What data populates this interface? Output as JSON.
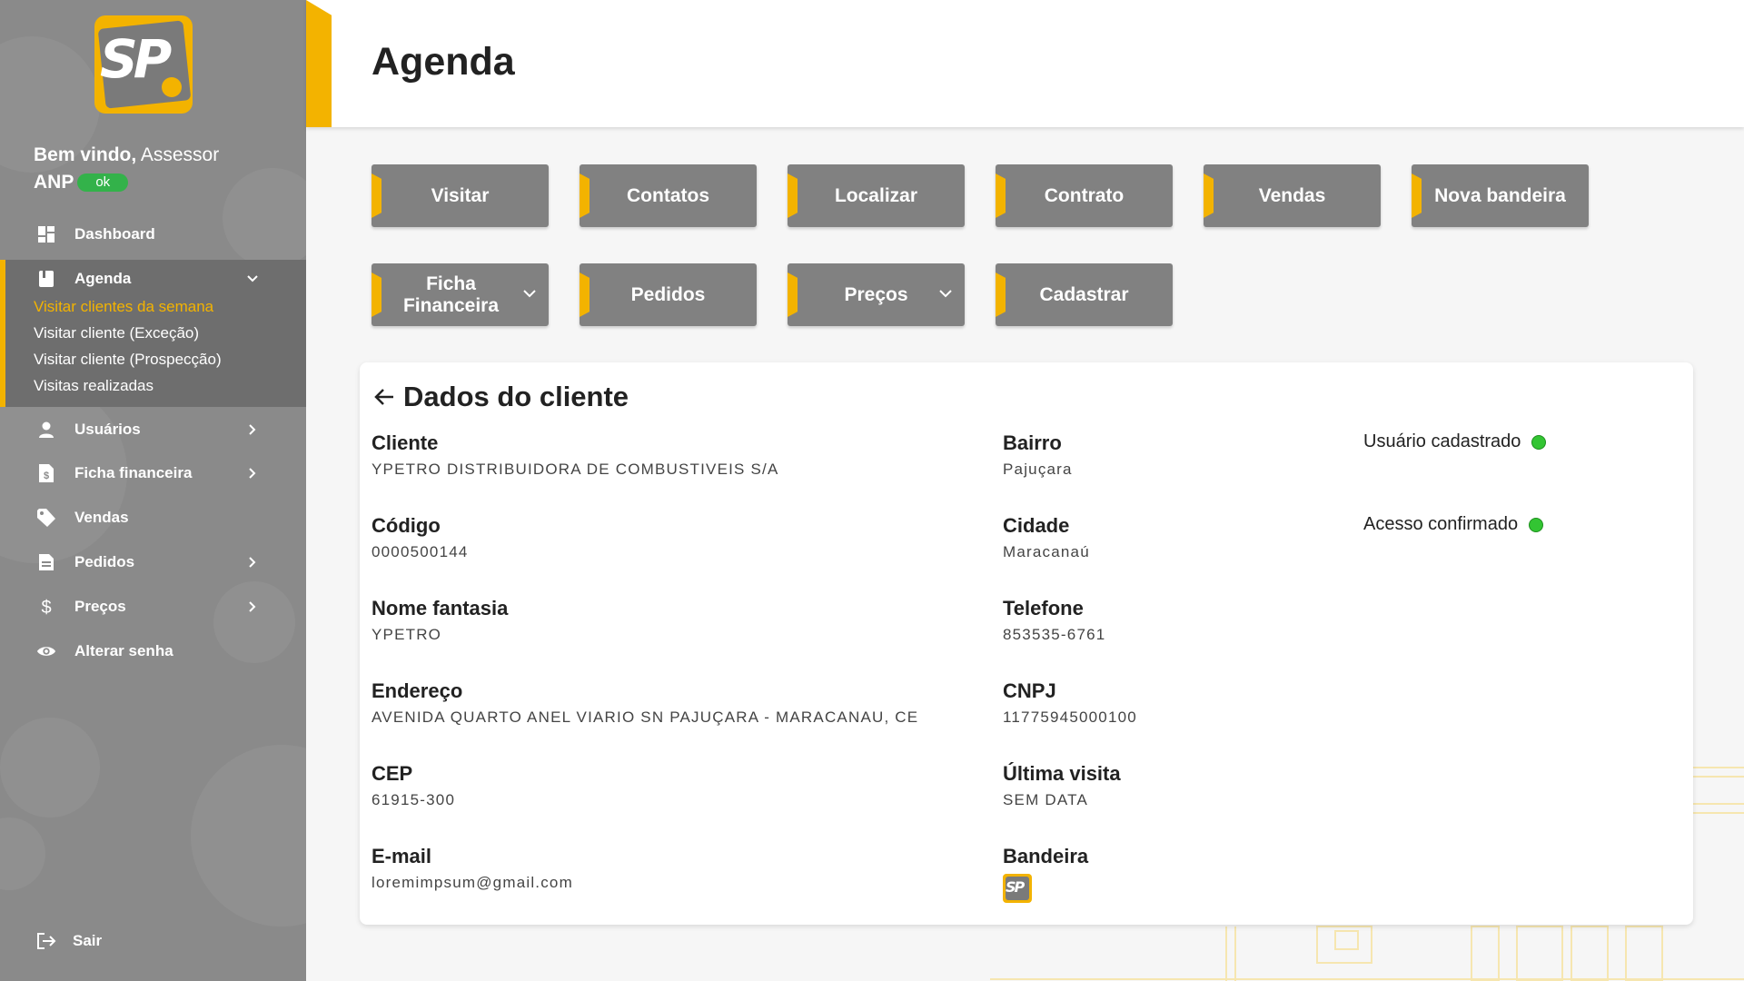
{
  "sidebar": {
    "logo_text": "SP",
    "welcome_bold": "Bem vindo,",
    "welcome_role": "Assessor",
    "welcome_org": "ANP",
    "status_badge": "ok",
    "items": [
      {
        "label": "Dashboard",
        "icon": "dashboard-icon"
      },
      {
        "label": "Agenda",
        "icon": "book-icon"
      },
      {
        "label": "Usuários",
        "icon": "person-icon"
      },
      {
        "label": "Ficha financeira",
        "icon": "invoice-icon"
      },
      {
        "label": "Vendas",
        "icon": "tag-icon"
      },
      {
        "label": "Pedidos",
        "icon": "document-icon"
      },
      {
        "label": "Preços",
        "icon": "dollar-icon"
      },
      {
        "label": "Alterar senha",
        "icon": "eye-icon"
      }
    ],
    "agenda_sub": [
      "Visitar clientes da semana",
      "Visitar cliente (Exceção)",
      "Visitar cliente  (Prospecção)",
      "Visitas realizadas"
    ],
    "logout": "Sair"
  },
  "header": {
    "title": "Agenda"
  },
  "actions": {
    "visitar": "Visitar",
    "contatos": "Contatos",
    "localizar": "Localizar",
    "contrato": "Contrato",
    "vendas": "Vendas",
    "nova_bandeira": "Nova bandeira",
    "ficha_financeira": "Ficha Financeira",
    "pedidos": "Pedidos",
    "precos": "Preços",
    "cadastrar": "Cadastrar"
  },
  "client": {
    "title": "Dados do cliente",
    "cliente_label": "Cliente",
    "cliente_value": "YPETRO DISTRIBUIDORA DE COMBUSTIVEIS S/A",
    "codigo_label": "Código",
    "codigo_value": "0000500144",
    "fantasia_label": "Nome fantasia",
    "fantasia_value": "YPETRO",
    "endereco_label": "Endereço",
    "endereco_value": "AVENIDA QUARTO ANEL VIARIO SN PAJUÇARA - MARACANAU, CE",
    "cep_label": "CEP",
    "cep_value": "61915-300",
    "email_label": "E-mail",
    "email_value": "loremimpsum@gmail.com",
    "bairro_label": "Bairro",
    "bairro_value": "Pajuçara",
    "cidade_label": "Cidade",
    "cidade_value": "Maracanaú",
    "telefone_label": "Telefone",
    "telefone_value": "853535-6761",
    "cnpj_label": "CNPJ",
    "cnpj_value": "11775945000100",
    "ultima_label": "Última visita",
    "ultima_value": "SEM DATA",
    "bandeira_label": "Bandeira",
    "bandeira_logo_text": "SP",
    "usuario_cadastrado": "Usuário cadastrado",
    "acesso_confirmado": "Acesso confirmado"
  },
  "colors": {
    "accent": "#f3b300",
    "sidebar": "#8a8a8a",
    "button": "#818181",
    "status_ok": "#33c533"
  }
}
